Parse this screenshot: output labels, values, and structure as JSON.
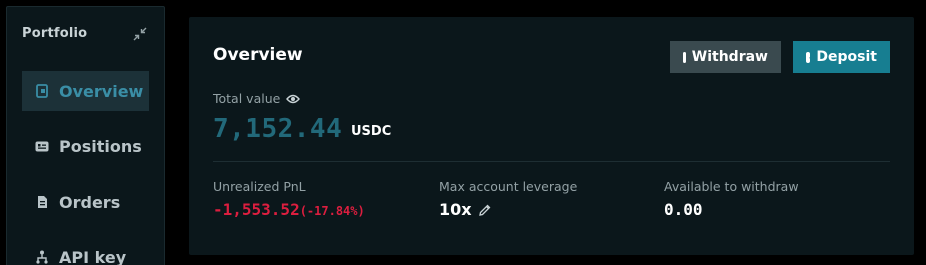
{
  "sidebar": {
    "title": "Portfolio",
    "items": [
      {
        "label": "Overview",
        "icon": "wallet-icon",
        "active": true
      },
      {
        "label": "Positions",
        "icon": "id-card-icon"
      },
      {
        "label": "Orders",
        "icon": "document-icon"
      },
      {
        "label": "API key",
        "icon": "network-icon"
      }
    ]
  },
  "overview": {
    "title": "Overview",
    "withdraw_label": "Withdraw",
    "deposit_label": "Deposit",
    "total_value_label": "Total value",
    "total_value": "7,152.44",
    "total_value_unit": "USDC",
    "stats": {
      "unrealized_pnl_label": "Unrealized PnL",
      "unrealized_pnl_value": "-1,553.52",
      "unrealized_pnl_pct": "(-17.84%)",
      "max_leverage_label": "Max account leverage",
      "max_leverage_value": "10x",
      "available_label": "Available to withdraw",
      "available_value": "0.00"
    }
  },
  "colors": {
    "accent": "#177e91",
    "active_text": "#3a8ea6",
    "negative": "#dc1e3f",
    "panel_bg": "#0b171b"
  }
}
